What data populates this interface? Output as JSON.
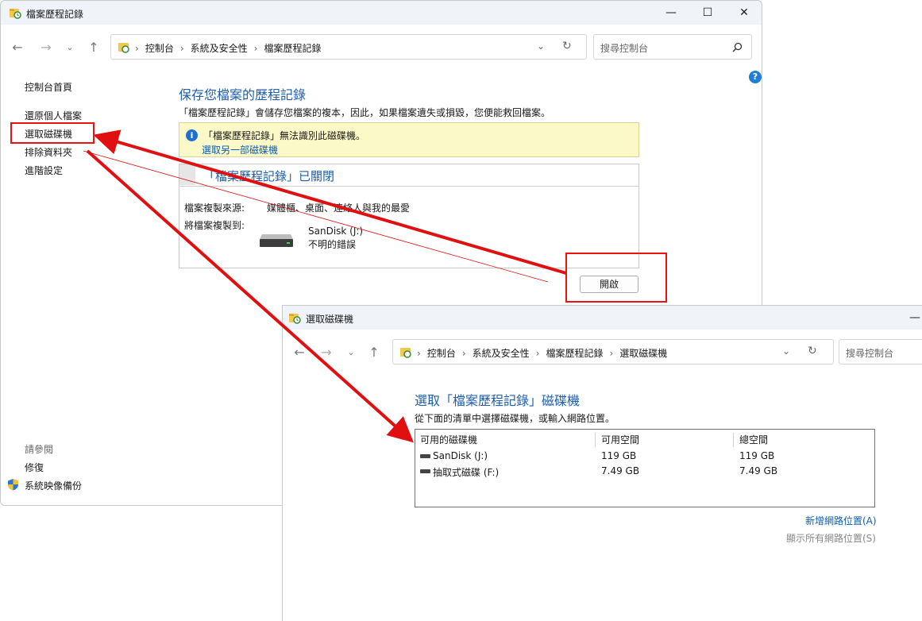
{
  "window1": {
    "title": "檔案歷程記錄",
    "controls": {
      "minimize": "—",
      "maximize": "☐",
      "close": "✕"
    },
    "breadcrumb": [
      "控制台",
      "系統及安全性",
      "檔案歷程記錄"
    ],
    "search_placeholder": "搜尋控制台",
    "left_nav": {
      "home": "控制台首頁",
      "restore": "還原個人檔案",
      "select_drive": "選取磁碟機",
      "exclude": "排除資料夾",
      "advanced": "進階設定"
    },
    "see_also": {
      "heading": "請參閱",
      "repair": "修復",
      "system_image": "系統映像備份"
    },
    "main": {
      "title": "保存您檔案的歷程記錄",
      "description": "「檔案歷程記錄」會儲存您檔案的複本，因此，如果檔案遺失或損毀，您便能救回檔案。",
      "warning_text": "「檔案歷程記錄」無法識別此磁碟機。",
      "warning_link": "選取另一部磁碟機",
      "status_title": "「檔案歷程記錄」已關閉",
      "copy_from_label": "檔案複製來源:",
      "copy_from_value": "媒體櫃、桌面、連絡人與我的最愛",
      "copy_to_label": "將檔案複製到:",
      "drive_name": "SanDisk (J:)",
      "drive_status": "不明的錯誤",
      "turn_on_button": "開啟"
    }
  },
  "window2": {
    "title": "選取磁碟機",
    "breadcrumb": [
      "控制台",
      "系統及安全性",
      "檔案歷程記錄",
      "選取磁碟機"
    ],
    "search_placeholder": "搜尋控制台",
    "heading": "選取「檔案歷程記錄」磁碟機",
    "description": "從下面的清單中選擇磁碟機，或輸入網路位置。",
    "columns": [
      "可用的磁碟機",
      "可用空間",
      "總空間"
    ],
    "drives": [
      {
        "name": "SanDisk (J:)",
        "free": "119 GB",
        "total": "119 GB"
      },
      {
        "name": "抽取式磁碟 (F:)",
        "free": "7.49 GB",
        "total": "7.49 GB"
      }
    ],
    "add_network": "新增網路位置(A)",
    "show_all_network": "顯示所有網路位置(S)"
  },
  "annotation_color": "#e01010",
  "accent_color": "#1e5eaa"
}
